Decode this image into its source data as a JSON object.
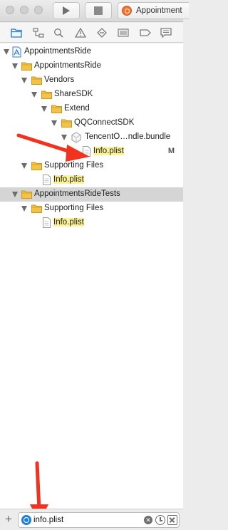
{
  "toolbar": {
    "scheme_label": "Appointment"
  },
  "navigator": {
    "tabs": [
      "project-navigator-icon",
      "symbol-navigator-icon",
      "find-navigator-icon",
      "issue-navigator-icon",
      "test-navigator-icon",
      "debug-navigator-icon",
      "breakpoint-navigator-icon",
      "report-navigator-icon"
    ]
  },
  "tree": {
    "rows": [
      {
        "label": "AppointmentsRide",
        "type": "project"
      },
      {
        "label": "AppointmentsRide",
        "type": "folder"
      },
      {
        "label": "Vendors",
        "type": "folder"
      },
      {
        "label": "ShareSDK",
        "type": "folder"
      },
      {
        "label": "Extend",
        "type": "folder"
      },
      {
        "label": "QQConnectSDK",
        "type": "folder"
      },
      {
        "label": "TencentO…ndle.bundle",
        "type": "bundle"
      },
      {
        "label": "Info.plist",
        "type": "file",
        "highlighted": true,
        "status": "M"
      },
      {
        "label": "Supporting Files",
        "type": "folder"
      },
      {
        "label": "Info.plist",
        "type": "file",
        "highlighted": true
      },
      {
        "label": "AppointmentsRideTests",
        "type": "folder",
        "selected": true
      },
      {
        "label": "Supporting Files",
        "type": "folder"
      },
      {
        "label": "Info.plist",
        "type": "file",
        "highlighted": true
      }
    ]
  },
  "filter": {
    "value": "info.plist",
    "add_label": "+"
  },
  "colors": {
    "annotation_arrow": "#f0321e",
    "folder": "#f3c247",
    "highlight": "#fbf196",
    "selection": "#d5d5d5"
  }
}
